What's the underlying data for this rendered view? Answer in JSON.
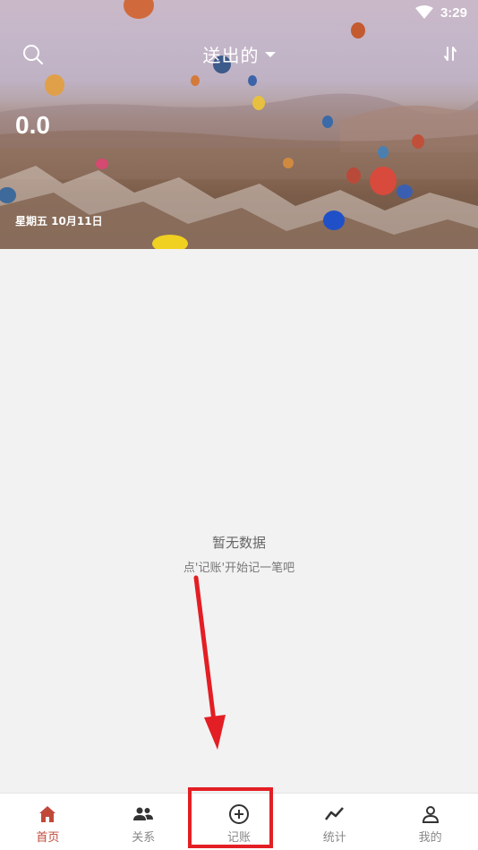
{
  "status_bar": {
    "time": "3:29",
    "wifi_icon": "wifi-icon"
  },
  "header": {
    "title": "送出的",
    "search_icon": "search-icon",
    "sort_icon": "sort-icon",
    "balance": "0.0",
    "date": "星期五 10月11日"
  },
  "empty_state": {
    "title": "暂无数据",
    "hint": "点'记账'开始记一笔吧"
  },
  "bottom_nav": {
    "items": [
      {
        "label": "首页",
        "icon": "home-icon",
        "active": true
      },
      {
        "label": "关系",
        "icon": "people-icon",
        "active": false
      },
      {
        "label": "记账",
        "icon": "add-circle-icon",
        "active": false
      },
      {
        "label": "统计",
        "icon": "stats-icon",
        "active": false
      },
      {
        "label": "我的",
        "icon": "profile-icon",
        "active": false
      }
    ]
  },
  "colors": {
    "accent": "#c0493a",
    "annotation": "#e31e24",
    "background": "#f2f2f2"
  }
}
